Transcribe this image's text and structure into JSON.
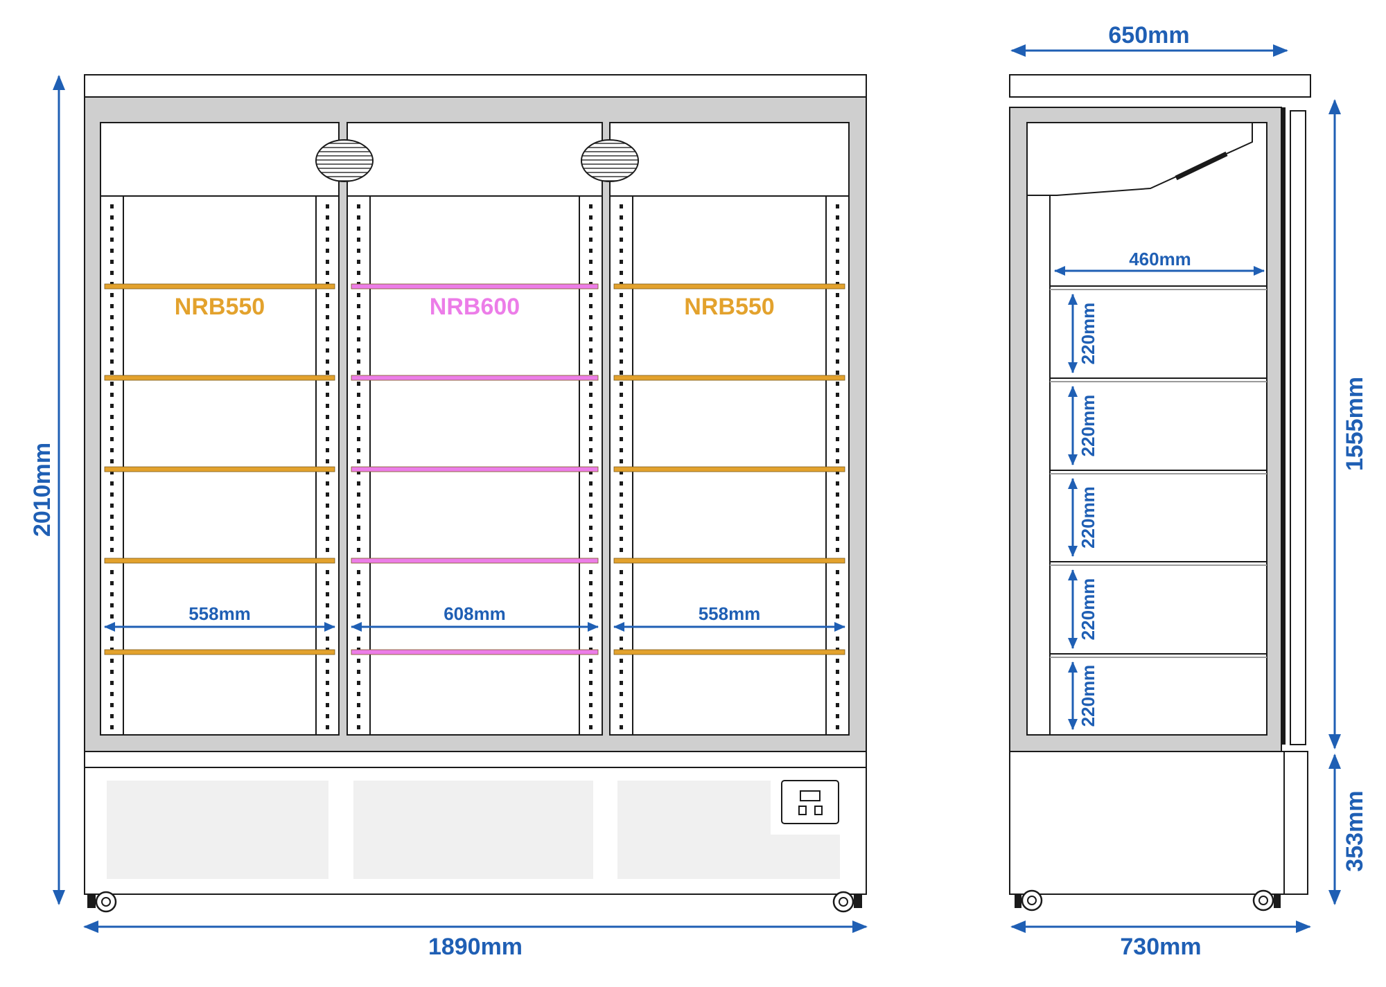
{
  "colors": {
    "dimension": "#1f5fb4",
    "nrb550": "#e3a22d",
    "nrb600": "#ec7de8",
    "outline": "#1a1a1a",
    "frame": "#cfcfcf",
    "panel": "#f0f0f0"
  },
  "front_view": {
    "overall_width": "1890mm",
    "overall_height": "2010mm",
    "sections": [
      {
        "label": "NRB550",
        "inner_width": "558mm",
        "shelf_type": "nrb550"
      },
      {
        "label": "NRB600",
        "inner_width": "608mm",
        "shelf_type": "nrb600"
      },
      {
        "label": "NRB550",
        "inner_width": "558mm",
        "shelf_type": "nrb550"
      }
    ],
    "icons": [
      "fan-icon",
      "fan-icon",
      "control-panel-icon",
      "caster-wheel-icon",
      "caster-wheel-icon"
    ]
  },
  "side_view": {
    "top_width": "650mm",
    "bottom_width": "730mm",
    "interior_height": "1555mm",
    "base_height": "353mm",
    "shelf_depth": "460mm",
    "shelf_spacings": [
      "220mm",
      "220mm",
      "220mm",
      "220mm",
      "220mm"
    ]
  }
}
